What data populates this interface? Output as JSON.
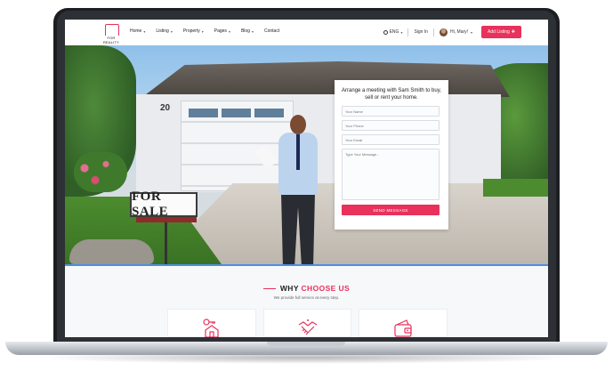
{
  "nav": {
    "brand": "FOR REALITY",
    "menu": [
      {
        "label": "Home"
      },
      {
        "label": "Listing"
      },
      {
        "label": "Property"
      },
      {
        "label": "Pages"
      },
      {
        "label": "Blog"
      },
      {
        "label": "Contact"
      }
    ],
    "language": "ENG",
    "sign_in": "Sign In",
    "user_greeting": "Hi, Mary!",
    "add_listing": "Add Listing"
  },
  "hero": {
    "house_number": "20",
    "sign_text": "FOR SALE"
  },
  "contact_form": {
    "title": "Arrange a meeting with Sam Smith to buy, sell or rent your home.",
    "name_placeholder": "Your Name",
    "phone_placeholder": "Your Phone",
    "email_placeholder": "Your Email",
    "message_placeholder": "Type Your Message...",
    "submit_label": "SEND MESSAGE"
  },
  "why": {
    "title_prefix": "WHY",
    "title_accent": "CHOOSE US",
    "subtitle": "We provide full service at every step.",
    "cards": [
      {
        "icon": "house-key-icon"
      },
      {
        "icon": "handshake-icon"
      },
      {
        "icon": "wallet-icon"
      }
    ]
  },
  "colors": {
    "accent": "#e8315b",
    "divider_blue": "#4a90e2"
  }
}
